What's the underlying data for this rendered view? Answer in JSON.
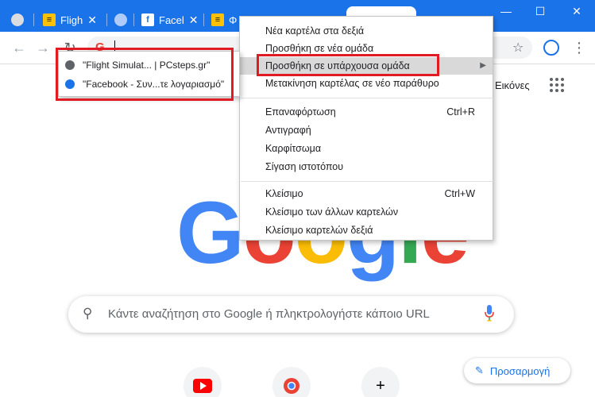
{
  "tabs": [
    {
      "label": "Fligh",
      "type": "pc"
    },
    {
      "label": "Facel",
      "type": "fb"
    },
    {
      "label": "Φ",
      "type": "pc"
    }
  ],
  "window": {
    "minimize": "—",
    "maximize": "☐",
    "close": "✕"
  },
  "homepage": {
    "images_link": "Εικόνες",
    "logo": "Google",
    "search_placeholder": "Κάντε αναζήτηση στο Google ή πληκτρολογήστε κάποιο URL",
    "customize": "Προσαρμογή",
    "add_shortcut": "+"
  },
  "context_menu": {
    "items": [
      {
        "label": "Νέα καρτέλα στα δεξιά",
        "shortcut": ""
      },
      {
        "label": "Προσθήκη σε νέα ομάδα",
        "shortcut": ""
      },
      {
        "label": "Προσθήκη σε υπάρχουσα ομάδα",
        "shortcut": ""
      },
      {
        "label": "Μετακίνηση καρτέλας σε νέο παράθυρο",
        "shortcut": ""
      },
      {
        "label": "Επαναφόρτωση",
        "shortcut": "Ctrl+R"
      },
      {
        "label": "Αντιγραφή",
        "shortcut": ""
      },
      {
        "label": "Καρφίτσωμα",
        "shortcut": ""
      },
      {
        "label": "Σίγαση ιστοτόπου",
        "shortcut": ""
      },
      {
        "label": "Κλείσιμο",
        "shortcut": "Ctrl+W"
      },
      {
        "label": "Κλείσιμο των άλλων καρτελών",
        "shortcut": ""
      },
      {
        "label": "Κλείσιμο καρτελών δεξιά",
        "shortcut": ""
      }
    ],
    "highlighted": "Προσθήκη σε υπάρχουσα ομάδα"
  },
  "submenu": {
    "groups": [
      {
        "label": "\"Flight Simulat... | PCsteps.gr\"",
        "color": "#5f6368"
      },
      {
        "label": "\"Facebook - Συν...τε λογαριασμό\"",
        "color": "#1a73e8"
      }
    ]
  },
  "colors": {
    "accent": "#1a73e8",
    "highlight_border": "#e01b24"
  }
}
